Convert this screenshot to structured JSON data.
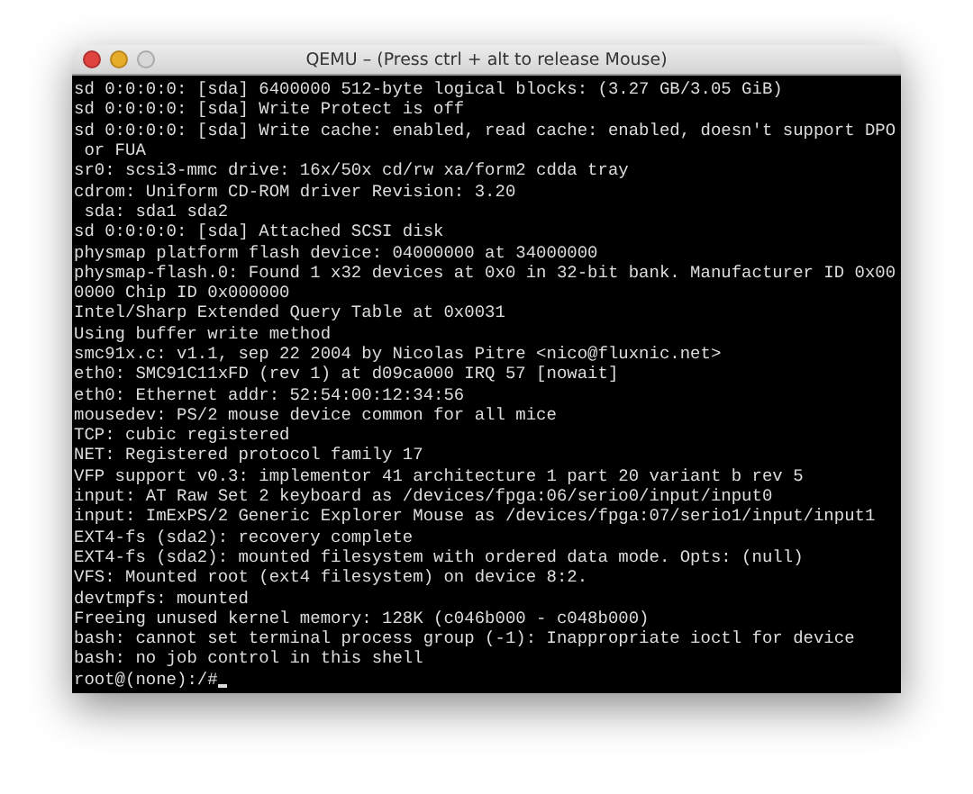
{
  "window": {
    "title": "QEMU – (Press ctrl + alt to release Mouse)"
  },
  "console": {
    "lines": [
      "sd 0:0:0:0: [sda] 6400000 512-byte logical blocks: (3.27 GB/3.05 GiB)",
      "sd 0:0:0:0: [sda] Write Protect is off",
      "sd 0:0:0:0: [sda] Write cache: enabled, read cache: enabled, doesn't support DPO",
      " or FUA",
      "sr0: scsi3-mmc drive: 16x/50x cd/rw xa/form2 cdda tray",
      "cdrom: Uniform CD-ROM driver Revision: 3.20",
      " sda: sda1 sda2",
      "sd 0:0:0:0: [sda] Attached SCSI disk",
      "physmap platform flash device: 04000000 at 34000000",
      "physmap-flash.0: Found 1 x32 devices at 0x0 in 32-bit bank. Manufacturer ID 0x00",
      "0000 Chip ID 0x000000",
      "Intel/Sharp Extended Query Table at 0x0031",
      "Using buffer write method",
      "smc91x.c: v1.1, sep 22 2004 by Nicolas Pitre <nico@fluxnic.net>",
      "eth0: SMC91C11xFD (rev 1) at d09ca000 IRQ 57 [nowait]",
      "eth0: Ethernet addr: 52:54:00:12:34:56",
      "mousedev: PS/2 mouse device common for all mice",
      "TCP: cubic registered",
      "NET: Registered protocol family 17",
      "VFP support v0.3: implementor 41 architecture 1 part 20 variant b rev 5",
      "input: AT Raw Set 2 keyboard as /devices/fpga:06/serio0/input/input0",
      "input: ImExPS/2 Generic Explorer Mouse as /devices/fpga:07/serio1/input/input1",
      "EXT4-fs (sda2): recovery complete",
      "EXT4-fs (sda2): mounted filesystem with ordered data mode. Opts: (null)",
      "VFS: Mounted root (ext4 filesystem) on device 8:2.",
      "devtmpfs: mounted",
      "Freeing unused kernel memory: 128K (c046b000 - c048b000)",
      "bash: cannot set terminal process group (-1): Inappropriate ioctl for device",
      "bash: no job control in this shell",
      "root@(none):/#"
    ]
  }
}
